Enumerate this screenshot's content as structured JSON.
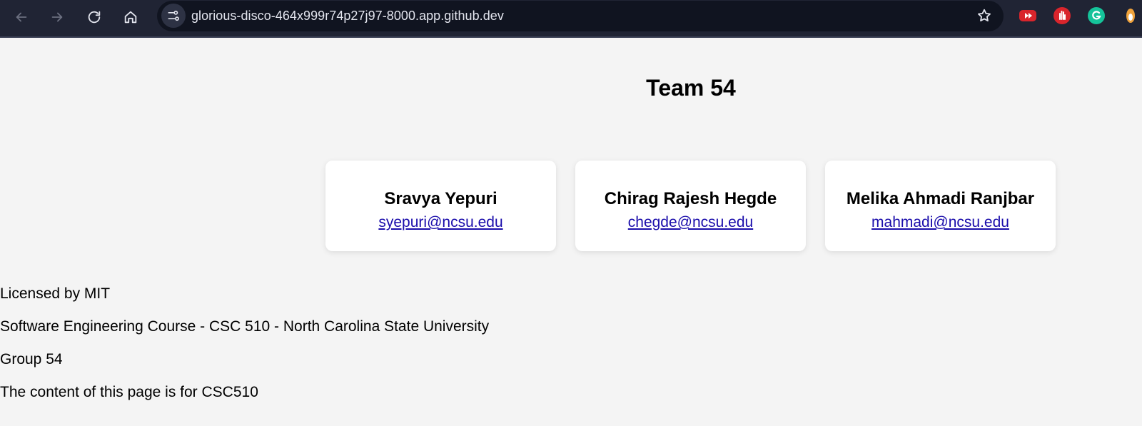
{
  "browser": {
    "url": "glorious-disco-464x999r74p27j97-8000.app.github.dev",
    "nav_icons": [
      "back-arrow-icon",
      "forward-arrow-icon",
      "reload-icon",
      "home-icon"
    ],
    "extensions": [
      "youtube-extension-icon",
      "hand-extension-icon",
      "grammarly-extension-icon",
      "profile-extension-icon"
    ]
  },
  "page": {
    "title": "Team 54",
    "members": [
      {
        "name": "Sravya Yepuri",
        "email": "syepuri@ncsu.edu"
      },
      {
        "name": "Chirag Rajesh Hegde",
        "email": "chegde@ncsu.edu"
      },
      {
        "name": "Melika Ahmadi Ranjbar",
        "email": "mahmadi@ncsu.edu"
      }
    ],
    "footer": {
      "license": "Licensed by MIT",
      "course": "Software Engineering Course - CSC 510 - North Carolina State University",
      "group": "Group 54",
      "note": "The content of this page is for CSC510"
    }
  },
  "colors": {
    "toolbar_bg": "#202434",
    "omnibox_bg": "#101420",
    "page_bg": "#f4f4f4",
    "link": "#1a0dab"
  }
}
